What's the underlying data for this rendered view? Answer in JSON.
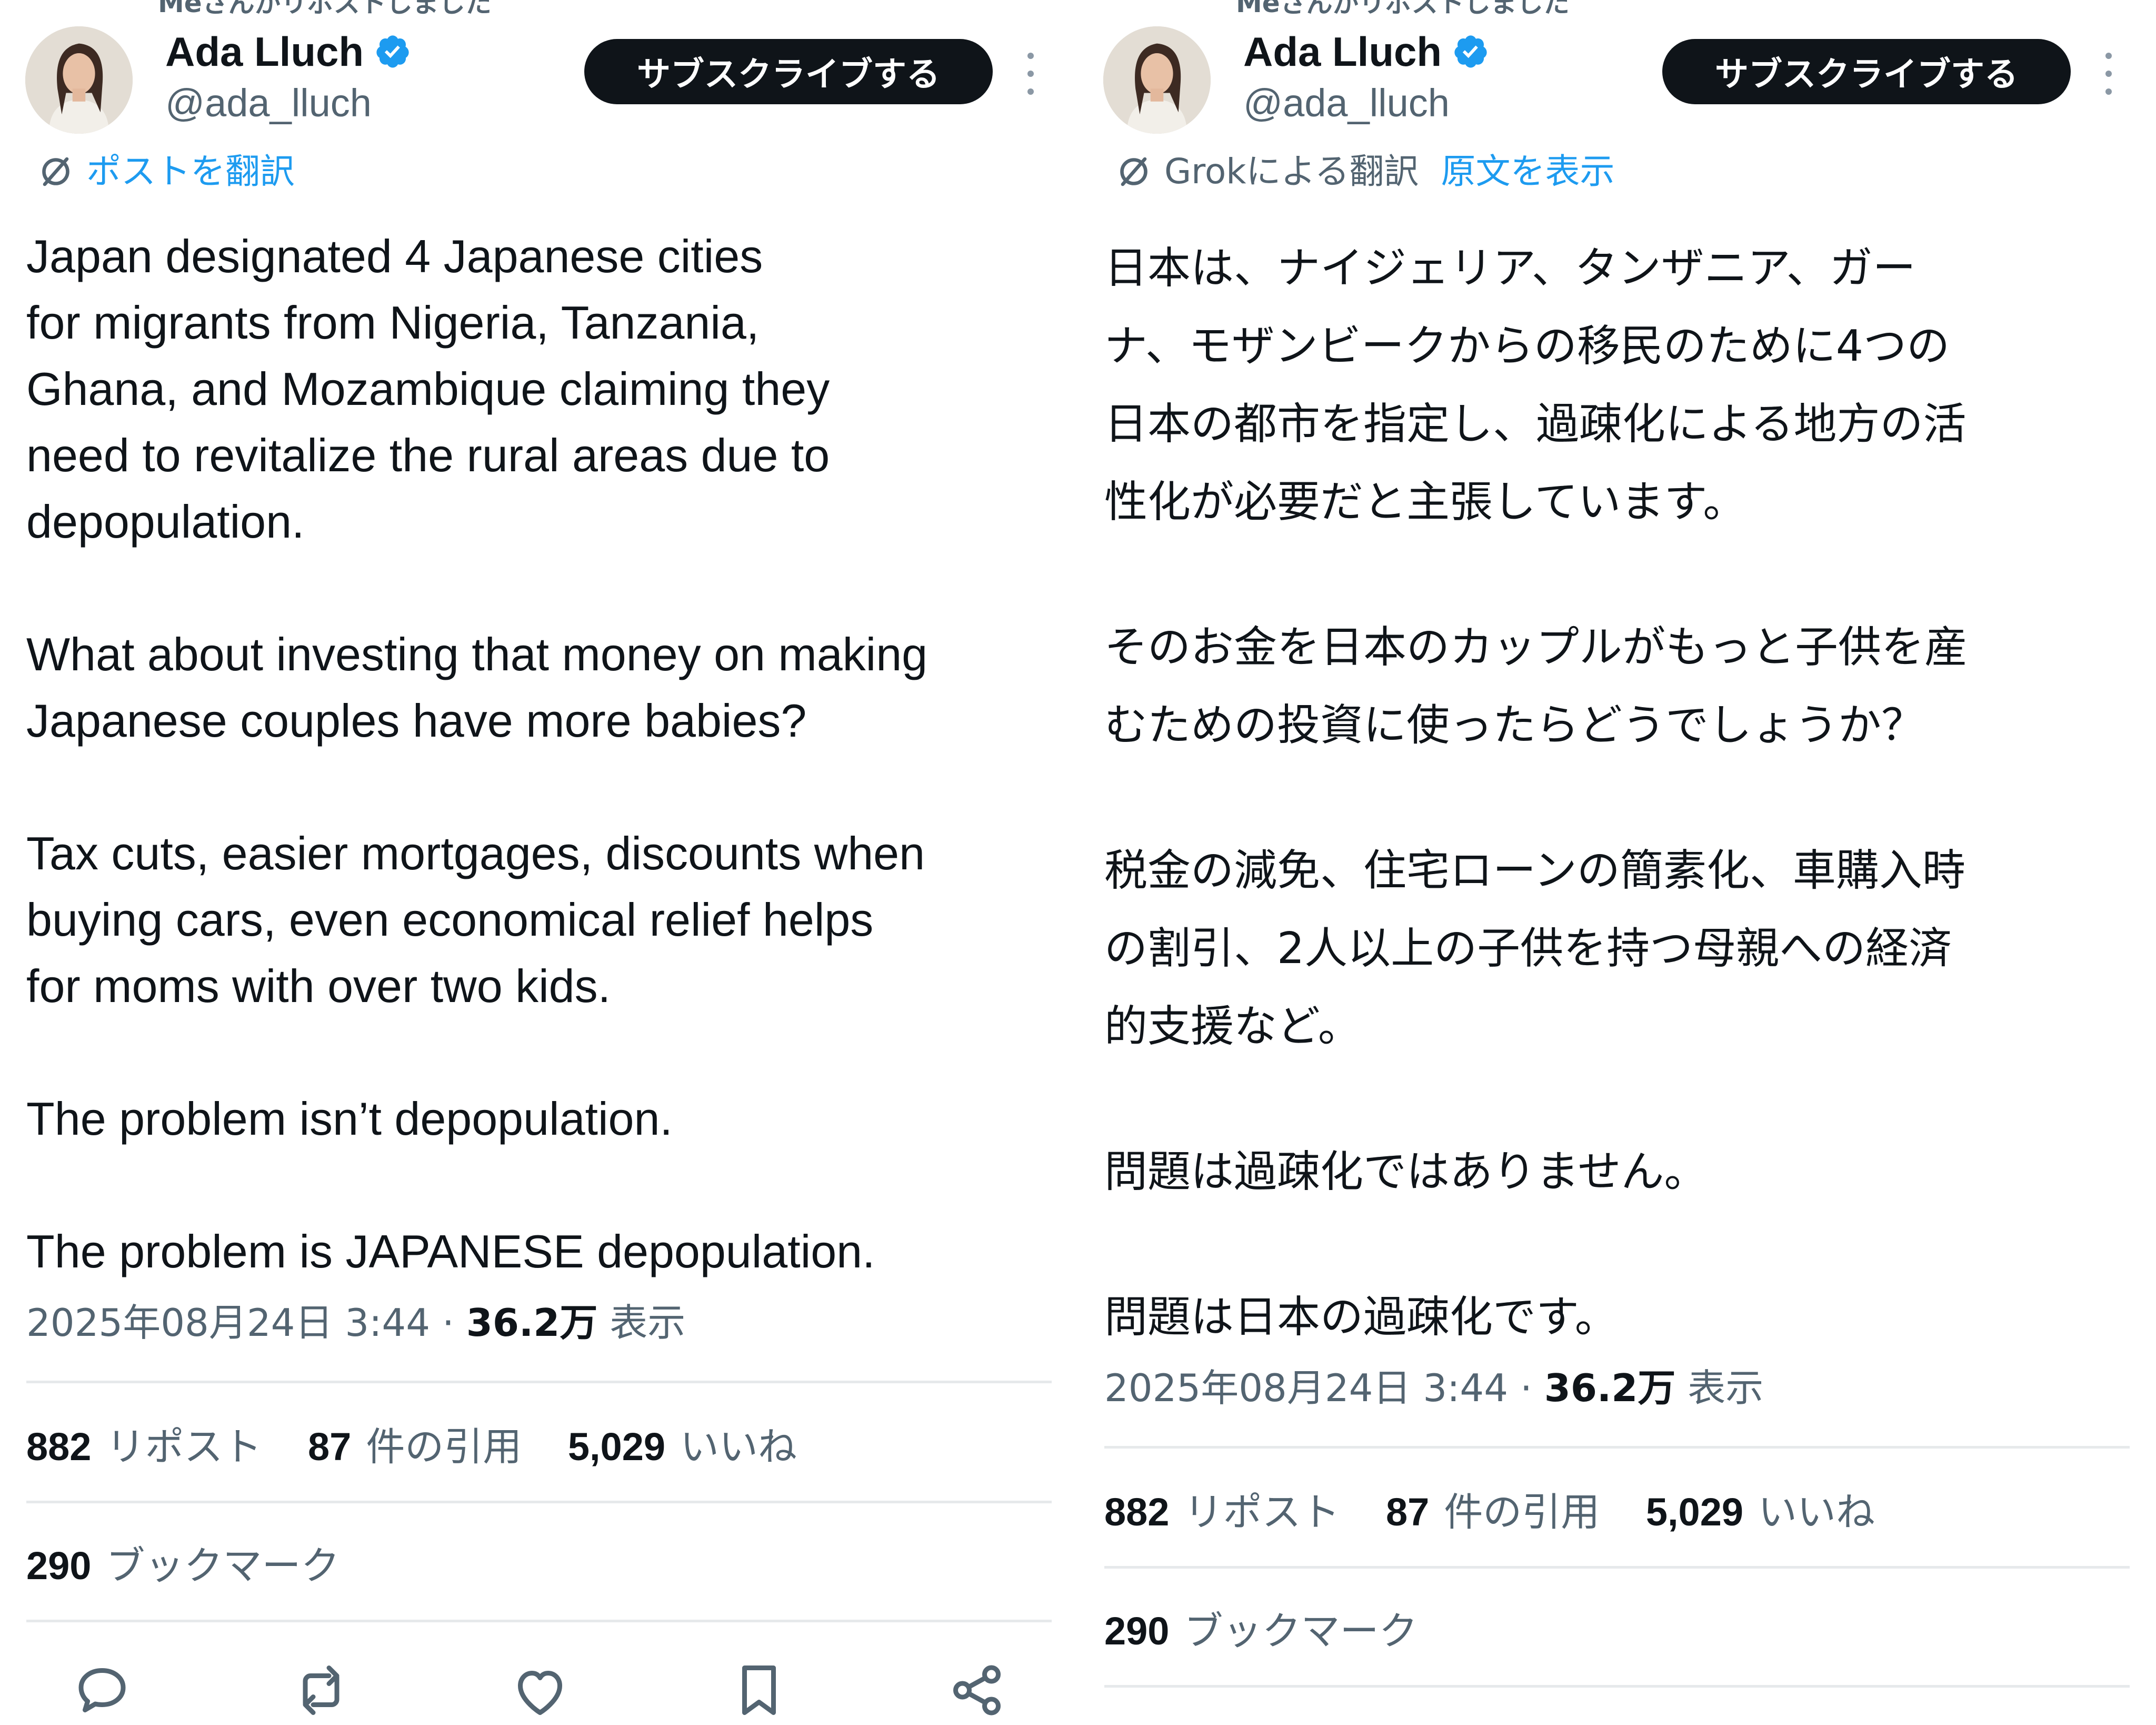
{
  "colors": {
    "text": "#0f1419",
    "muted": "#536471",
    "link": "#1d9bf0",
    "subscribe_bg": "#0f1419",
    "verified": "#1d9bf0",
    "divider": "#e6e9eb"
  },
  "left": {
    "cut_text": "Meさんがリポストしました",
    "author": {
      "name": "Ada Lluch",
      "handle": "@ada_lluch",
      "verified": true
    },
    "subscribe_label": "サブスクライブする",
    "translate_label": "ポストを翻訳",
    "paragraphs": [
      "Japan designated 4 Japanese cities\nfor migrants from Nigeria, Tanzania,\nGhana, and Mozambique claiming they\nneed to revitalize the rural areas due to\ndepopulation.",
      "What about investing that money on making\nJapanese couples have more babies?",
      "Tax cuts, easier mortgages, discounts when\nbuying cars, even economical relief helps\nfor moms with over two kids.",
      "The problem isn’t depopulation.",
      "The problem is JAPANESE depopulation."
    ],
    "meta": {
      "date": "2025年08月24日 3:44",
      "sep": "·",
      "views": "36.2万",
      "views_label": "表示"
    },
    "stats": {
      "reposts": "882",
      "reposts_label": "リポスト",
      "quotes": "87",
      "quotes_label": "件の引用",
      "likes": "5,029",
      "likes_label": "いいね",
      "bookmarks": "290",
      "bookmarks_label": "ブックマーク"
    },
    "actions": [
      "reply-icon",
      "repost-icon",
      "like-icon",
      "bookmark-icon",
      "share-icon"
    ]
  },
  "right": {
    "cut_text": "Meさんがリポストしました",
    "author": {
      "name": "Ada Lluch",
      "handle": "@ada_lluch",
      "verified": true
    },
    "subscribe_label": "サブスクライブする",
    "translated_by": "Grokによる翻訳",
    "show_original": "原文を表示",
    "paragraphs": [
      "日本は、ナイジェリア、タンザニア、ガー\nナ、モザンビークからの移民のために4つの\n日本の都市を指定し、過疎化による地方の活\n性化が必要だと主張しています。",
      "そのお金を日本のカップルがもっと子供を産\nむための投資に使ったらどうでしょうか？",
      "税金の減免、住宅ローンの簡素化、車購入時\nの割引、2人以上の子供を持つ母親への経済\n的支援など。",
      "問題は過疎化ではありません。",
      "問題は日本の過疎化です。"
    ],
    "meta": {
      "date": "2025年08月24日 3:44",
      "sep": "·",
      "views": "36.2万",
      "views_label": "表示"
    },
    "stats": {
      "reposts": "882",
      "reposts_label": "リポスト",
      "quotes": "87",
      "quotes_label": "件の引用",
      "likes": "5,029",
      "likes_label": "いいね",
      "bookmarks": "290",
      "bookmarks_label": "ブックマーク"
    }
  }
}
